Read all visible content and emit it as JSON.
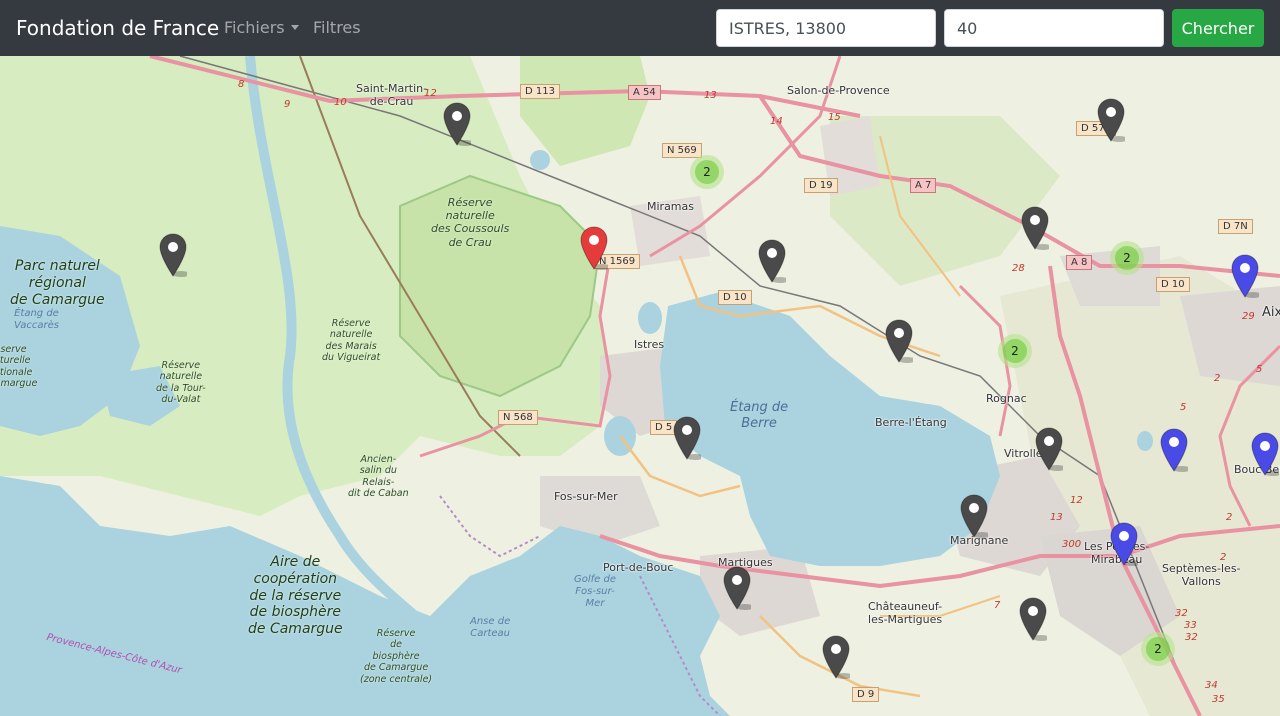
{
  "navbar": {
    "brand": "Fondation de France",
    "menu_fichiers": "Fichiers",
    "menu_filtres": "Filtres",
    "search_city_value": "ISTRES, 13800",
    "search_radius_value": "40",
    "search_button": "Chercher"
  },
  "map": {
    "places": {
      "saint_martin_1": "Saint-Martin-",
      "saint_martin_2": "de-Crau",
      "salon": "Salon-de-Provence",
      "miramas": "Miramas",
      "istres": "Istres",
      "fos": "Fos-sur-Mer",
      "port_de_bouc": "Port-de-Bouc",
      "martigues": "Martigues",
      "berre": "Berre-l'Étang",
      "rognac": "Rognac",
      "vitrolles": "Vitrolles",
      "marignane": "Marignane",
      "chateauneuf_1": "Châteauneuf-",
      "chateauneuf_2": "les-Martigues",
      "les_pennes_1": "Les Pennes-",
      "les_pennes_2": "Mirabeau",
      "septemes_1": "Septèmes-les-",
      "septemes_2": "Vallons",
      "aix": "Aix",
      "bouc_bel": "Bouc-Bel"
    },
    "reserves": {
      "coussouls": [
        "Réserve",
        "naturelle",
        "des Coussouls",
        "de Crau"
      ],
      "marais_vigueirat": [
        "Réserve",
        "naturelle",
        "des Marais",
        "du Vigueirat"
      ],
      "tour_du_valat": [
        "Réserve",
        "naturelle",
        "de la Tour-",
        "du-Valat"
      ],
      "ancien_salin": [
        "Ancien-",
        "salin du",
        "Relais-",
        "dit de Caban"
      ],
      "reserve_biosphere_camargue": [
        "Réserve",
        "de",
        "biosphère",
        "de Camargue",
        "(zone centrale)"
      ],
      "reserve_naturelle_left": [
        "Réserve",
        "naturelle",
        "nationale",
        "Camargue"
      ]
    },
    "parks": {
      "camargue_park": [
        "Parc naturel",
        "régional",
        "de Camargue"
      ],
      "aire_cooperation": [
        "Aire de",
        "coopération",
        "de la réserve",
        "de biosphère",
        "de Camargue"
      ]
    },
    "water": {
      "etang_berre": [
        "Étang de",
        "Berre"
      ],
      "golfe_fos": [
        "Golfe de",
        "Fos-sur-",
        "Mer"
      ],
      "anse_carteau": [
        "Anse de",
        "Carteau"
      ],
      "etang_vaccares": [
        "Étang de",
        "Vaccarès"
      ]
    },
    "roads": {
      "d113": "D 113",
      "a54": "A 54",
      "n569": "N 569",
      "d19": "D 19",
      "a7": "A 7",
      "d572": "D 572",
      "d7n": "D 7N",
      "a8": "A 8",
      "d10_east": "D 10",
      "n1569": "N 1569",
      "d10": "D 10",
      "n568": "N 568",
      "d5": "D 5",
      "d9": "D 9"
    },
    "road_numbers": {
      "r8": "8",
      "r9": "9",
      "r10": "10",
      "r12": "12",
      "r13": "13",
      "r14": "14",
      "r15": "15",
      "r28": "28",
      "r29": "29",
      "r5a": "5",
      "r5b": "5",
      "r2a": "2",
      "r2b": "2",
      "r2c": "2",
      "r12b": "12",
      "r13b": "13",
      "r300": "300",
      "r7": "7",
      "r32a": "32",
      "r32b": "32",
      "r33": "33",
      "r34": "34",
      "r35": "35"
    },
    "region": "Provence-Alpes-Côte d'Azur",
    "colors": {
      "marker_grey": "#4a4a4a",
      "marker_red": "#e63b3b",
      "marker_blue": "#4a4ae6",
      "cluster_outer": "#b5e28c",
      "cluster_inner": "#6ecc39"
    },
    "markers": [
      {
        "color": "grey"
      },
      {
        "color": "grey"
      },
      {
        "color": "red"
      },
      {
        "color": "grey"
      },
      {
        "color": "grey"
      },
      {
        "color": "grey"
      },
      {
        "color": "blue"
      },
      {
        "color": "grey"
      },
      {
        "color": "grey"
      },
      {
        "color": "blue"
      },
      {
        "color": "blue"
      },
      {
        "color": "grey"
      },
      {
        "color": "blue"
      },
      {
        "color": "grey"
      },
      {
        "color": "grey"
      },
      {
        "color": "grey"
      },
      {
        "color": "grey"
      }
    ],
    "clusters": [
      {
        "count": "2"
      },
      {
        "count": "2"
      },
      {
        "count": "2"
      },
      {
        "count": "2"
      }
    ]
  }
}
